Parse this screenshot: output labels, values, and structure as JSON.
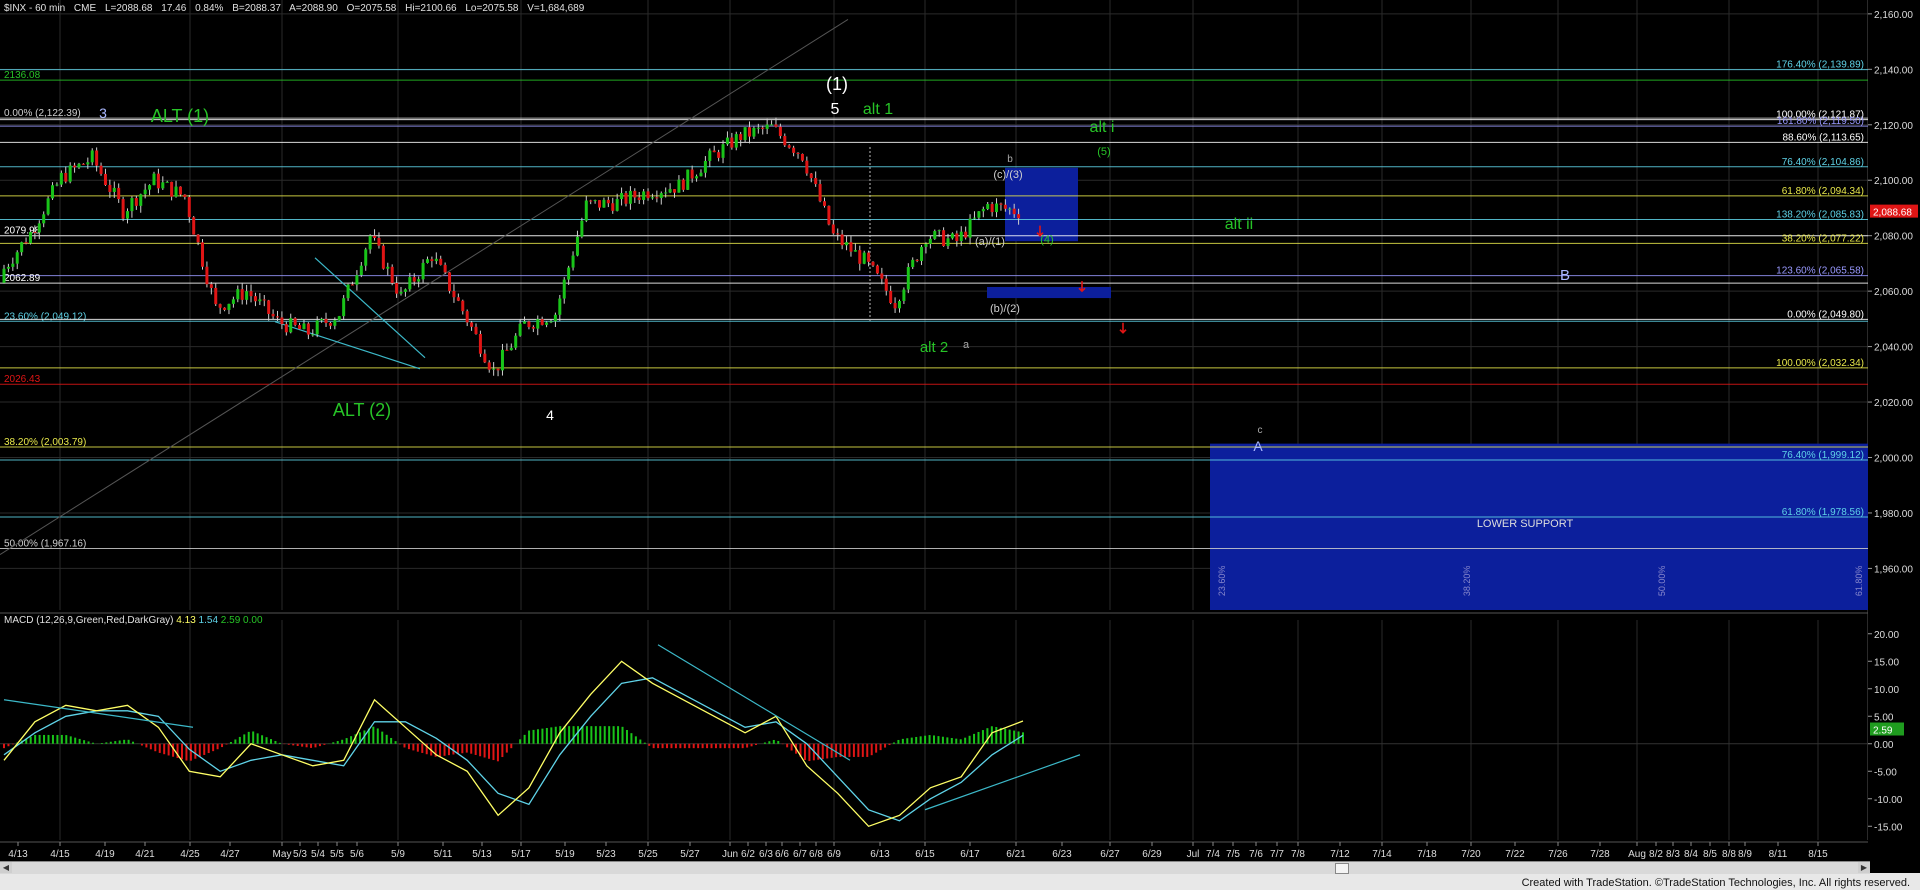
{
  "header": {
    "symbol": "$INX - 60 min",
    "exchange": "CME",
    "last": "L=2088.68",
    "change": "17.46",
    "change_pct": "0.84%",
    "bid": "B=2088.37",
    "ask": "A=2088.90",
    "open": "O=2075.58",
    "high": "Hi=2100.66",
    "low": "Lo=2075.58",
    "volume": "V=1,684,689"
  },
  "macd_header": {
    "name": "MACD (12,26,9,Green,Red,DarkGray)",
    "v1": "4.13",
    "v2": "1.54",
    "v3": "2.59",
    "v4": "0.00"
  },
  "footer": {
    "credit": "Created with TradeStation. ©TradeStation Technologies, Inc. All rights reserved."
  },
  "colors": {
    "background": "#000000",
    "grid": "#2a2a2a",
    "up": "#19c419",
    "down": "#e01515",
    "wick": "#cfcfcf",
    "blue_box": "#0c1f9c",
    "label_green": "#27c427",
    "label_white": "#e8e8e8",
    "macd_line": "#ffff66",
    "signal_line": "#5fd3e8",
    "trendline": "#3cb8c8",
    "arrow": "#e01515"
  },
  "chart_data": [
    {
      "type": "candlestick",
      "title": "$INX - 60 min",
      "ylim": [
        1945,
        2165
      ],
      "price_ticks": [
        2160,
        2140,
        2120,
        2100,
        2080,
        2060,
        2040,
        2020,
        2000,
        1980,
        1960
      ],
      "tick_labels_y": [
        "2,160.00",
        "2,140.00",
        "2,120.00",
        "2,100.00",
        "2,080.00",
        "2,060.00",
        "2,040.00",
        "2,020.00",
        "2,000.00",
        "1,980.00",
        "1,960.00"
      ],
      "x_labels": [
        "4/13",
        "4/15",
        "4/19",
        "4/21",
        "4/25",
        "4/27",
        "May",
        "5/3",
        "5/4",
        "5/5",
        "5/6",
        "5/9",
        "5/11",
        "5/13",
        "5/17",
        "5/19",
        "5/23",
        "5/25",
        "5/27",
        "Jun",
        "6/2",
        "6/3",
        "6/6",
        "6/7",
        "6/8",
        "6/9",
        "6/13",
        "6/15",
        "6/17",
        "6/21",
        "6/23",
        "6/27",
        "6/29",
        "Jul",
        "7/4",
        "7/5",
        "7/6",
        "7/7",
        "7/8",
        "7/12",
        "7/14",
        "7/18",
        "7/20",
        "7/22",
        "7/26",
        "7/28",
        "Aug",
        "8/2",
        "8/3",
        "8/4",
        "8/5",
        "8/8",
        "8/9",
        "8/11",
        "8/15"
      ],
      "current_price_label": "2,088.68",
      "current_price": 2088.68,
      "session_closes": [
        2066,
        2081,
        2101,
        2108,
        2089,
        2100,
        2094,
        2054,
        2060,
        2049,
        2045,
        2052,
        2080,
        2058,
        2073,
        2053,
        2031,
        2048,
        2052,
        2091,
        2092,
        2096,
        2098,
        2108,
        2116,
        2119,
        2109,
        2080,
        2071,
        2056,
        2080,
        2078,
        2091,
        2088.68
      ],
      "horizontal_levels": [
        {
          "price": 2136.08,
          "label": "2136.08",
          "side": "left",
          "color": "#27c427"
        },
        {
          "price": 2139.89,
          "label": "176.40% (2,139.89)",
          "side": "right",
          "color": "#5fd3e8"
        },
        {
          "price": 2122.39,
          "label": "0.00% (2,122.39)",
          "side": "left",
          "color": "#cfcfcf"
        },
        {
          "price": 2121.87,
          "label": "100.00% (2,121.87)",
          "side": "right",
          "color": "#ffffff"
        },
        {
          "price": 2119.5,
          "label": "161.80% (2,119.50)",
          "side": "right",
          "color": "#9999ff"
        },
        {
          "price": 2113.65,
          "label": "88.60% (2,113.65)",
          "side": "right",
          "color": "#ffffff"
        },
        {
          "price": 2104.86,
          "label": "76.40% (2,104.86)",
          "side": "right",
          "color": "#5fd3e8"
        },
        {
          "price": 2094.34,
          "label": "61.80% (2,094.34)",
          "side": "right",
          "color": "#e8e84a"
        },
        {
          "price": 2085.83,
          "label": "138.20% (2,085.83)",
          "side": "right",
          "color": "#5fd3e8"
        },
        {
          "price": 2079.98,
          "label": "2079.98",
          "side": "left",
          "color": "#ffffff"
        },
        {
          "price": 2077.22,
          "label": "38.20% (2,077.22)",
          "side": "right",
          "color": "#e8e84a"
        },
        {
          "price": 2065.58,
          "label": "123.60% (2,065.58)",
          "side": "right",
          "color": "#9999ff"
        },
        {
          "price": 2062.89,
          "label": "2062.89",
          "side": "left",
          "color": "#ffffff"
        },
        {
          "price": 2049.12,
          "label": "23.60% (2,049.12)",
          "side": "left",
          "color": "#5fd3e8"
        },
        {
          "price": 2049.8,
          "label": "0.00% (2,049.80)",
          "side": "right",
          "color": "#ffffff"
        },
        {
          "price": 2032.34,
          "label": "100.00% (2,032.34)",
          "side": "right",
          "color": "#e8e84a"
        },
        {
          "price": 2026.43,
          "label": "2026.43",
          "side": "left",
          "color": "#e01515"
        },
        {
          "price": 2003.79,
          "label": "38.20% (2,003.79)",
          "side": "left",
          "color": "#e8e84a"
        },
        {
          "price": 1999.12,
          "label": "76.40% (1,999.12)",
          "side": "right",
          "color": "#5fd3e8"
        },
        {
          "price": 1978.56,
          "label": "61.80% (1,978.56)",
          "side": "right",
          "color": "#5fd3e8"
        },
        {
          "price": 1967.16,
          "label": "50.00% (1,967.16)",
          "side": "left",
          "color": "#cfcfcf"
        }
      ],
      "wave_labels": [
        {
          "text": "(1)",
          "color": "#ffffff"
        },
        {
          "text": "3",
          "color": "#aab8ff"
        },
        {
          "text": "ALT (1)",
          "color": "#27c427"
        },
        {
          "text": "5",
          "color": "#ffffff"
        },
        {
          "text": "alt 1",
          "color": "#27c427"
        },
        {
          "text": "alt i",
          "color": "#27c427"
        },
        {
          "text": "(5)",
          "color": "#27c427"
        },
        {
          "text": "b",
          "color": "#aaaaaa"
        },
        {
          "text": "(c)/(3)",
          "color": "#cfcfcf"
        },
        {
          "text": "alt ii",
          "color": "#27c427"
        },
        {
          "text": "(a)/(1)",
          "color": "#cfcfcf"
        },
        {
          "text": "(4)",
          "color": "#27c427"
        },
        {
          "text": "B",
          "color": "#aab8ff"
        },
        {
          "text": "(b)/(2)",
          "color": "#cfcfcf"
        },
        {
          "text": "alt 2",
          "color": "#27c427"
        },
        {
          "text": "a",
          "color": "#aaaaaa"
        },
        {
          "text": "ALT (2)",
          "color": "#27c427"
        },
        {
          "text": "4",
          "color": "#ffffff"
        },
        {
          "text": "c",
          "color": "#aaaaaa"
        },
        {
          "text": "A",
          "color": "#aab8ff"
        }
      ],
      "support_box_label": "LOWER SUPPORT",
      "box_fib_labels": [
        "23.60%",
        "38.20%",
        "50.00%",
        "61.80%"
      ]
    },
    {
      "type": "macd",
      "title": "MACD (12,26,9,Green,Red,DarkGray)",
      "ylim": [
        -17.5,
        22.5
      ],
      "tick_labels_y": [
        "20.00",
        "15.00",
        "10.00",
        "5.00",
        "0.00",
        "-5.00",
        "-10.00",
        "-15.00"
      ],
      "current_value_label": "2.59",
      "macd_values": [
        -3,
        4,
        7,
        6,
        7,
        3,
        -5,
        -6,
        0,
        -2,
        -4,
        -3,
        8,
        3,
        -2,
        -5,
        -13,
        -8,
        2,
        9,
        15,
        11,
        8,
        5,
        2,
        5,
        -4,
        -9,
        -15,
        -13,
        -8,
        -6,
        2,
        4.13
      ],
      "signal_values": [
        -2,
        2,
        5,
        6,
        6,
        5,
        -1,
        -5,
        -3,
        -2,
        -3,
        -4,
        4,
        4,
        1,
        -3,
        -9,
        -11,
        -2,
        5,
        11,
        12,
        9,
        6,
        3,
        4,
        0,
        -6,
        -12,
        -14,
        -10,
        -7,
        -2,
        1.54
      ]
    }
  ]
}
